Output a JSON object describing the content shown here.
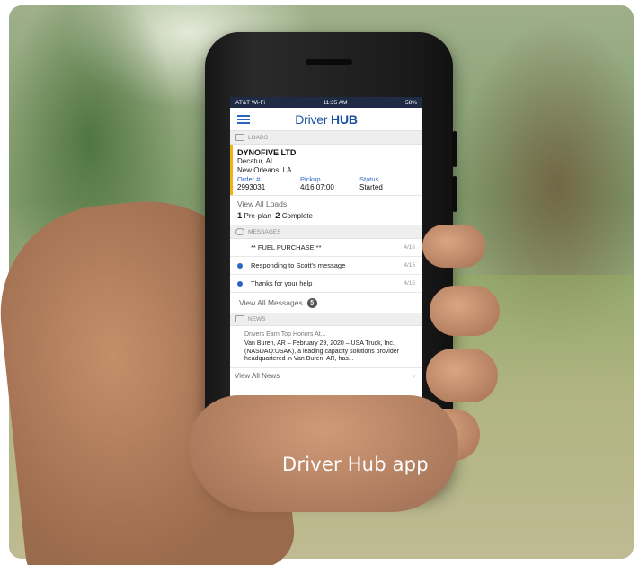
{
  "status_bar": {
    "carrier": "AT&T Wi-Fi",
    "time": "11:35 AM",
    "battery": "58%"
  },
  "app": {
    "logo_light": "Driver",
    "logo_bold": "HUB"
  },
  "loads": {
    "section_label": "LOADS",
    "company": "DYNOFIVE LTD",
    "origin": "Decatur, AL",
    "destination": "New Orleans, LA",
    "order_label": "Order #",
    "order_value": "2993031",
    "pickup_label": "Pickup",
    "pickup_value": "4/16 07:00",
    "status_label": "Status",
    "status_value": "Started",
    "view_all": "View All Loads",
    "preplan_count": "1",
    "preplan_label": "Pre-plan",
    "complete_count": "2",
    "complete_label": "Complete"
  },
  "messages": {
    "section_label": "MESSAGES",
    "items": [
      {
        "text": "** FUEL PURCHASE **",
        "date": "4/16",
        "unread": false
      },
      {
        "text": "Responding to Scott's message",
        "date": "4/15",
        "unread": true
      },
      {
        "text": "Thanks for your help",
        "date": "4/15",
        "unread": true
      }
    ],
    "view_all": "View All Messages",
    "badge": "5"
  },
  "news": {
    "section_label": "NEWS",
    "title": "Drivers Earn Top Honors At...",
    "body": "Van Buren, AR – February 29, 2020 – USA Truck, Inc. (NASDAQ:USAK), a leading capacity solutions provider headquartered in Van Buren, AR, has...",
    "view_all": "View All News"
  },
  "caption": "Driver Hub app",
  "colors": {
    "brand_blue": "#1b4fa3",
    "accent_yellow": "#f2b21a",
    "link_blue": "#2a66c0"
  }
}
